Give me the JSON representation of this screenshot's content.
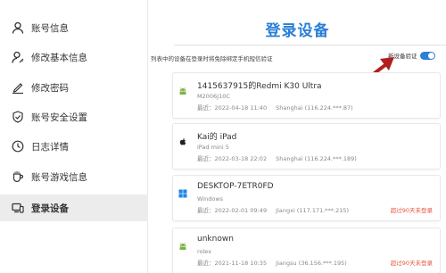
{
  "sidebar": {
    "items": [
      {
        "label": "账号信息",
        "icon": "user-icon",
        "active": false
      },
      {
        "label": "修改基本信息",
        "icon": "user-edit-icon",
        "active": false
      },
      {
        "label": "修改密码",
        "icon": "pen-icon",
        "active": false
      },
      {
        "label": "账号安全设置",
        "icon": "shield-check-icon",
        "active": false
      },
      {
        "label": "日志详情",
        "icon": "clock-icon",
        "active": false
      },
      {
        "label": "账号游戏信息",
        "icon": "game-cup-icon",
        "active": false
      },
      {
        "label": "登录设备",
        "icon": "devices-icon",
        "active": true
      }
    ]
  },
  "main": {
    "title": "登录设备",
    "hint": "列表中的设备在登录时将免除绑定手机短信验证",
    "toggle": {
      "label": "新设备验证",
      "enabled": true
    },
    "devices": [
      {
        "name": "1415637915的Redmi K30 Ultra",
        "model": "M2006J10C",
        "last_login": "最近：2022-04-18 11:40",
        "location": "Shanghai (116.224.***.87)",
        "os": "android-icon",
        "expired": ""
      },
      {
        "name": "Kai的 iPad",
        "model": "iPad mini 5",
        "last_login": "最近：2022-03-18 22:02",
        "location": "Shanghai (116.224.***.189)",
        "os": "apple-icon",
        "expired": ""
      },
      {
        "name": "DESKTOP-7ETR0FD",
        "model": "Windows",
        "last_login": "最近：2022-02-01 09:49",
        "location": "Jiangxi (117.171.***.215)",
        "os": "windows-icon",
        "expired": "超过90天未登录"
      },
      {
        "name": "unknown",
        "model": "rolex",
        "last_login": "最近：2021-11-18 10:35",
        "location": "Jiangsu (36.156.***.195)",
        "os": "android-icon",
        "expired": "超过90天未登录"
      }
    ]
  },
  "colors": {
    "accent": "#2a7fd6",
    "expired": "#e8543e",
    "arrow": "#b01e1e",
    "android": "#7cb342",
    "windows": "#1e88e5"
  }
}
